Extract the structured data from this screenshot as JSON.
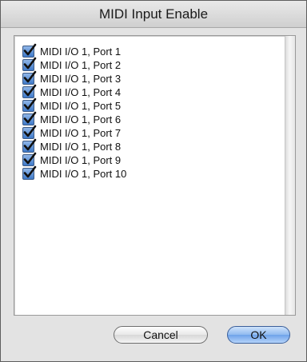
{
  "window": {
    "title": "MIDI Input Enable"
  },
  "ports": [
    {
      "label": "MIDI I/O 1, Port 1",
      "checked": true
    },
    {
      "label": "MIDI I/O 1, Port 2",
      "checked": true
    },
    {
      "label": "MIDI I/O 1, Port 3",
      "checked": true
    },
    {
      "label": "MIDI I/O 1, Port 4",
      "checked": true
    },
    {
      "label": "MIDI I/O 1, Port 5",
      "checked": true
    },
    {
      "label": "MIDI I/O 1, Port 6",
      "checked": true
    },
    {
      "label": "MIDI I/O 1, Port 7",
      "checked": true
    },
    {
      "label": "MIDI I/O 1, Port 8",
      "checked": true
    },
    {
      "label": "MIDI I/O 1, Port 9",
      "checked": true
    },
    {
      "label": "MIDI I/O 1, Port 10",
      "checked": true
    }
  ],
  "buttons": {
    "cancel_label": "Cancel",
    "ok_label": "OK"
  },
  "colors": {
    "checkbox_accent": "#3e79c8",
    "default_button": "#8fbaf0"
  }
}
